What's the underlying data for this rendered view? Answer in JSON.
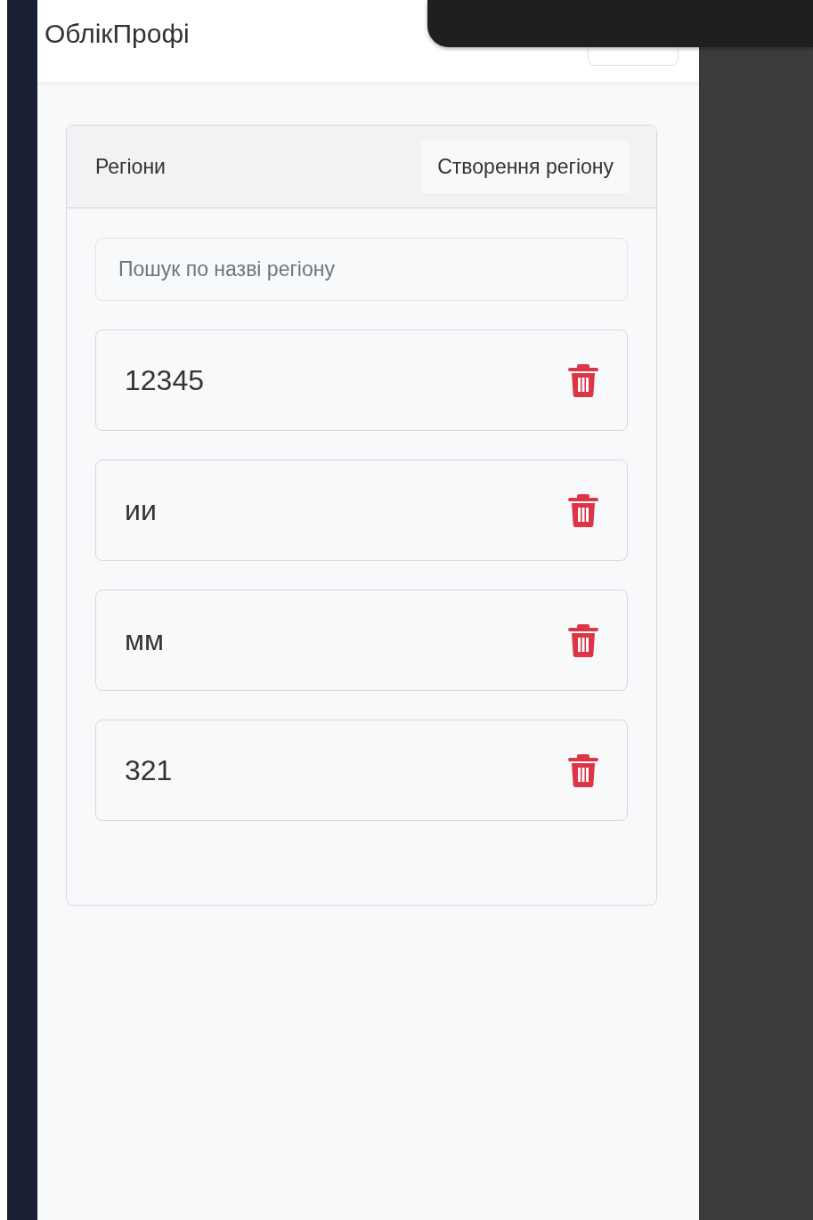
{
  "app": {
    "title": "ОблікПрофі"
  },
  "card": {
    "title": "Регіони",
    "create_button": "Створення регіону"
  },
  "search": {
    "placeholder": "Пошук по назві регіону"
  },
  "regions": [
    {
      "name": "12345"
    },
    {
      "name": "ии"
    },
    {
      "name": "мм"
    },
    {
      "name": "321"
    }
  ]
}
